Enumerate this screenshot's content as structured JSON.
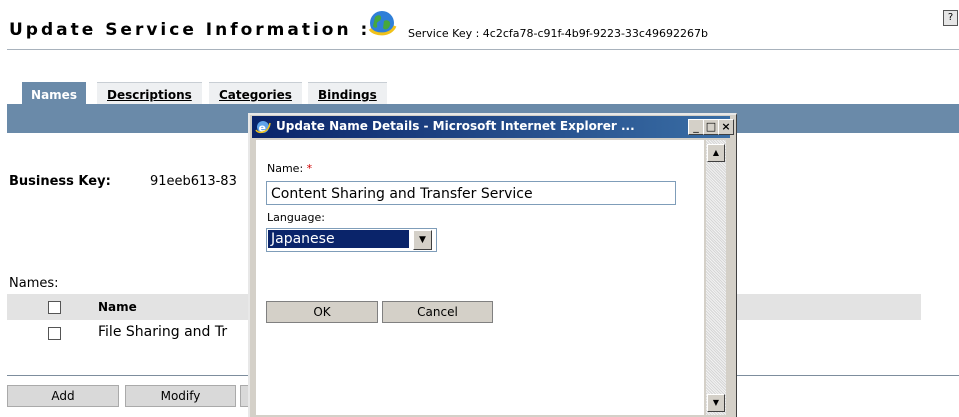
{
  "page": {
    "title": "Update Service Information :",
    "service_key_label": "Service Key : 4c2cfa78-c91f-4b9f-9223-33c49692267b",
    "help_icon": "help-icon"
  },
  "tabs": [
    {
      "label": "Names",
      "active": true
    },
    {
      "label": "Descriptions",
      "active": false
    },
    {
      "label": "Categories",
      "active": false
    },
    {
      "label": "Bindings",
      "active": false
    }
  ],
  "business": {
    "label": "Business Key:",
    "value": "91eeb613-83"
  },
  "names_table": {
    "label": "Names:",
    "header": "Name",
    "rows": [
      "File Sharing and Tr"
    ]
  },
  "actions": {
    "add": "Add",
    "modify": "Modify"
  },
  "dialog": {
    "title": "Update Name Details - Microsoft Internet Explorer ...",
    "name_label": "Name:",
    "required_mark": "*",
    "name_value": "Content Sharing and Transfer Service",
    "language_label": "Language:",
    "language_value": "Japanese",
    "ok": "OK",
    "cancel": "Cancel"
  },
  "colors": {
    "tab_bar": "#6a8aa9",
    "dialog_title": "#0a246a",
    "selection": "#0a246a",
    "required": "#d00000"
  }
}
